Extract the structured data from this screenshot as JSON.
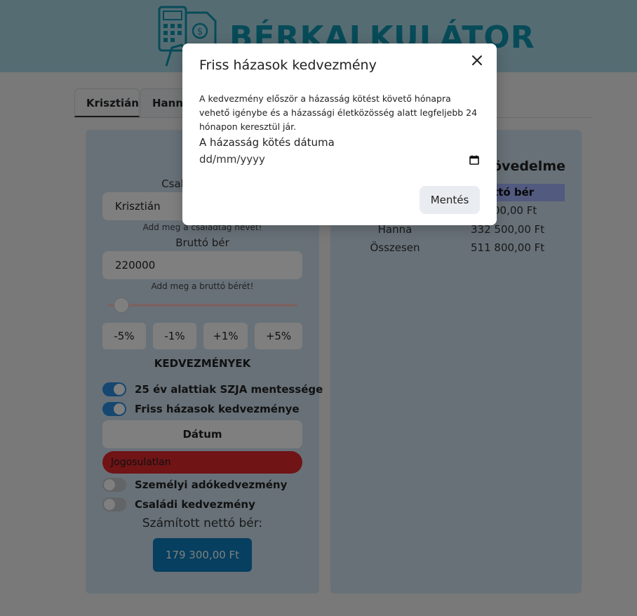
{
  "header": {
    "title": "BÉRKALKULÁTOR"
  },
  "tabs": [
    {
      "label": "Krisztián"
    },
    {
      "label": "Hanna"
    }
  ],
  "form": {
    "member_label": "Családtag neve",
    "name_value": "Krisztián",
    "name_hint": "Add meg a családtag nevét!",
    "gross_label": "Bruttó bér",
    "gross_value": "220000",
    "gross_hint": "Add meg a bruttó bérét!",
    "slider_fraction": 0.05,
    "pct_buttons": [
      "-5%",
      "-1%",
      "+1%",
      "+5%"
    ],
    "benefits_title": "KEDVEZMÉNYEK",
    "benefits": [
      {
        "label": "25 év alattiak SZJA mentessége",
        "on": true
      },
      {
        "label": "Friss házasok kedvezménye",
        "on": true
      },
      {
        "label": "Személyi adókedvezmény",
        "on": false
      },
      {
        "label": "Családi kedvezmény",
        "on": false
      }
    ],
    "date_button": "Dátum",
    "status_badge": "Jogosulatlan",
    "net_label": "Számított nettó bér:",
    "net_value": "179 300,00 Ft"
  },
  "summary": {
    "title_fragment": "övedelme",
    "col_net": "ttó bér",
    "rows": [
      {
        "name": "",
        "value": "00,00 Ft"
      },
      {
        "name": "Hanna",
        "value": "332 500,00 Ft"
      },
      {
        "name": "Összesen",
        "value": "511 800,00 Ft"
      }
    ]
  },
  "modal": {
    "title": "Friss házasok kedvezmény",
    "text": "A kedvezmény először a házasság kötést követő hónapra vehető igénybe és a házassági életközösség alatt legfeljebb 24 hónapon keresztül jár.",
    "date_label": "A házasság kötés dátuma",
    "date_placeholder": "dd/mm/yyyy",
    "save_label": "Mentés"
  },
  "colors": {
    "header_bg": "#add8e6",
    "logo": "#0e97b0",
    "toggle_on": "#2a8ee0",
    "status_red": "#e0282d",
    "net_button": "#0c7ebf",
    "table_header": "#a4b4ff"
  },
  "icons": [
    "calculator-icon",
    "money-document-icon",
    "close-icon",
    "calendar-icon"
  ]
}
